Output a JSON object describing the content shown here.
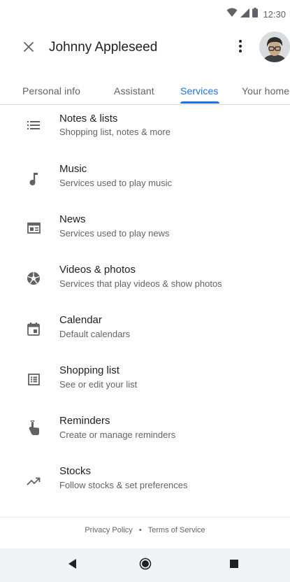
{
  "status_bar": {
    "time": "12:30",
    "icons": [
      "wifi-icon",
      "signal-icon",
      "battery-icon"
    ]
  },
  "header": {
    "close_icon": "close-icon",
    "account_name": "Johnny Appleseed",
    "more_icon": "more-vert-icon",
    "avatar": "avatar-photo"
  },
  "tabs": [
    {
      "label": "Personal info",
      "active": false
    },
    {
      "label": "Assistant",
      "active": false
    },
    {
      "label": "Services",
      "active": true
    },
    {
      "label": "Your home",
      "active": false
    }
  ],
  "services": [
    {
      "title": "Notes & lists",
      "subtitle": "Shopping list, notes & more",
      "icon": "list-icon"
    },
    {
      "title": "Music",
      "subtitle": "Services used to play music",
      "icon": "music-note-icon"
    },
    {
      "title": "News",
      "subtitle": "Services used to play news",
      "icon": "news-icon"
    },
    {
      "title": "Videos & photos",
      "subtitle": "Services that play videos & show photos",
      "icon": "camera-aperture-icon"
    },
    {
      "title": "Calendar",
      "subtitle": "Default calendars",
      "icon": "calendar-icon"
    },
    {
      "title": "Shopping list",
      "subtitle": "See or edit your list",
      "icon": "shopping-list-icon"
    },
    {
      "title": "Reminders",
      "subtitle": "Create or manage reminders",
      "icon": "reminder-hand-icon"
    },
    {
      "title": "Stocks",
      "subtitle": "Follow stocks & set preferences",
      "icon": "trending-up-icon"
    }
  ],
  "footer": {
    "privacy": "Privacy Policy",
    "separator": "•",
    "terms": "Terms of Service"
  },
  "nav": {
    "back": "back-icon",
    "home": "home-icon",
    "recents": "recents-icon"
  },
  "colors": {
    "accent": "#1a73e8",
    "text_primary": "#202124",
    "text_secondary": "#5f6368",
    "icon": "#5f6368",
    "nav_bar": "#f1f3f4"
  }
}
